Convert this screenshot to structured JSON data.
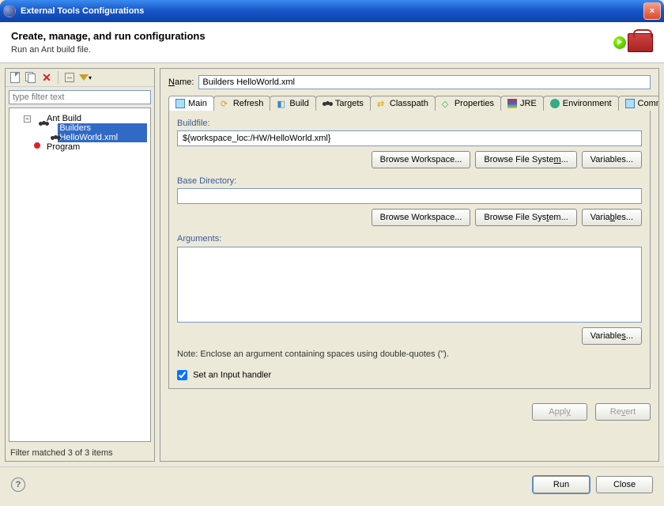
{
  "window": {
    "title": "External Tools Configurations"
  },
  "header": {
    "title": "Create, manage, and run configurations",
    "subtitle": "Run an Ant build file."
  },
  "left": {
    "filter_placeholder": "type filter text",
    "tree": {
      "root": "Ant Build",
      "child_selected": "Builders HelloWorld.xml",
      "program": "Program"
    },
    "status": "Filter matched 3 of 3 items"
  },
  "right": {
    "name_hint": "N",
    "name_label": "ame:",
    "name_value": "Builders HelloWorld.xml",
    "tabs": {
      "main": "Main",
      "refresh": "Refresh",
      "build": "Build",
      "targets": "Targets",
      "classpath": "Classpath",
      "properties": "Properties",
      "jre": "JRE",
      "environment": "Environment",
      "common": "Common"
    },
    "buildfile": {
      "legend": "Buildfile:",
      "value": "${workspace_loc:/HW/HelloWorld.xml}",
      "browse_ws": "Browse Workspace...",
      "browse_fs": "Browse File System...",
      "vars": "Variables..."
    },
    "basedir": {
      "legend": "Base Directory:",
      "value": "",
      "browse_ws": "Browse Workspace...",
      "browse_fs": "Browse File System...",
      "vars": "Variables..."
    },
    "arguments": {
      "legend_pre": "Ar",
      "legend_u": "g",
      "legend_post": "uments:",
      "value": "",
      "vars": "Variables...",
      "note": "Note: Enclose an argument containing spaces using double-quotes (\")."
    },
    "input_handler_pre": "Set an Input ",
    "input_handler_u": "h",
    "input_handler_post": "andler",
    "apply": "Apply",
    "revert": "Revert"
  },
  "footer": {
    "run": "Run",
    "close": "Close"
  }
}
